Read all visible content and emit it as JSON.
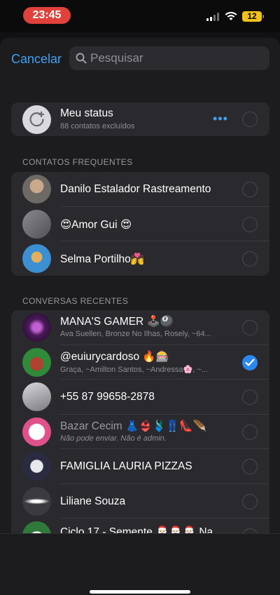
{
  "status_bar": {
    "time": "23:45",
    "battery": "12"
  },
  "header": {
    "cancel_label": "Cancelar",
    "search_placeholder": "Pesquisar"
  },
  "my_status": {
    "title": "Meu status",
    "subtitle": "88 contatos excluídos",
    "more": "•••"
  },
  "frequent": {
    "label": "CONTATOS FREQUENTES",
    "items": [
      {
        "name": "Danilo Estalador Rastreamento"
      },
      {
        "name": "😍Amor Gui 😍"
      },
      {
        "name": "Selma Portilho💏"
      }
    ]
  },
  "recent": {
    "label": "CONVERSAS RECENTES",
    "items": [
      {
        "name": "MANA'S GAMER 🕹️🎱",
        "subtitle": "Ava Suellen, Bronze No Ilhas, Rosely, ~64...",
        "checked": false
      },
      {
        "name": "@euiurycardoso 🔥🎰",
        "subtitle": "Graça, ~Amilton Santos, ~Andressa🌸, ~...",
        "checked": true
      },
      {
        "name": "+55 87 99658-2878",
        "subtitle": "",
        "checked": false
      },
      {
        "name": "Bazar Cecim 👗👙🩱👖👠🪶",
        "subtitle": "Não pode enviar. Não é admin.",
        "checked": false
      },
      {
        "name": "FAMIGLIA  LAURIA PIZZAS",
        "subtitle": "",
        "checked": false
      },
      {
        "name": "Liliane Souza",
        "subtitle": "",
        "checked": false
      },
      {
        "name": "Ciclo 17 - Semente 🎅🏻🎅🏻🎅🏻 Na",
        "subtitle": "",
        "checked": false
      }
    ]
  },
  "colors": {
    "accent": "#3ea1f0",
    "check": "#2a88f0",
    "time_pill": "#e0413b",
    "battery": "#f2c21b"
  }
}
